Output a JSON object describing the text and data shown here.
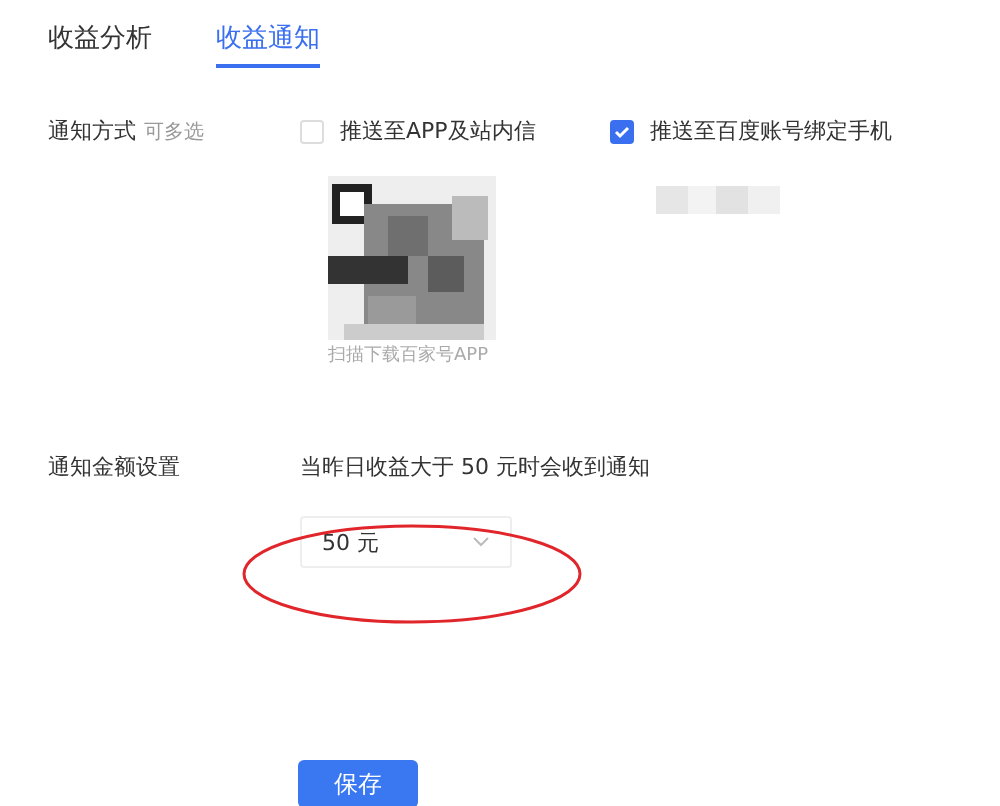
{
  "tabs": [
    {
      "label": "收益分析",
      "selected": false
    },
    {
      "label": "收益通知",
      "selected": true
    }
  ],
  "notify_method": {
    "label": "通知方式",
    "hint": "可多选",
    "options": [
      {
        "label": "推送至APP及站内信",
        "checked": false,
        "qr": {
          "kind": "picture",
          "caption": "扫描下载百家号APP"
        }
      },
      {
        "label": "推送至百度账号绑定手机",
        "checked": true
      }
    ]
  },
  "amount_setting": {
    "label": "通知金额设置",
    "description": "当昨日收益大于 50 元时会收到通知",
    "select": {
      "value": "50 元"
    },
    "annotation": {
      "kind": "ellipse",
      "color": "#e0262b"
    }
  },
  "save_button": {
    "label": "保存"
  }
}
